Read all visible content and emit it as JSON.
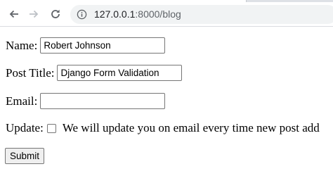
{
  "browser": {
    "url_host": "127.0.0.1",
    "url_path": ":8000/blog"
  },
  "icons": {
    "back": "back-arrow-icon",
    "forward": "forward-arrow-icon",
    "reload": "reload-icon",
    "info": "info-circle-icon"
  },
  "form": {
    "name_label": "Name:",
    "name_value": "Robert Johnson",
    "post_title_label": "Post Title:",
    "post_title_value": "Django Form Validation",
    "email_label": "Email:",
    "email_value": "",
    "update_label": "Update:",
    "update_checked": false,
    "update_text": "We will update you on email every time new post add",
    "submit_label": "Submit"
  }
}
